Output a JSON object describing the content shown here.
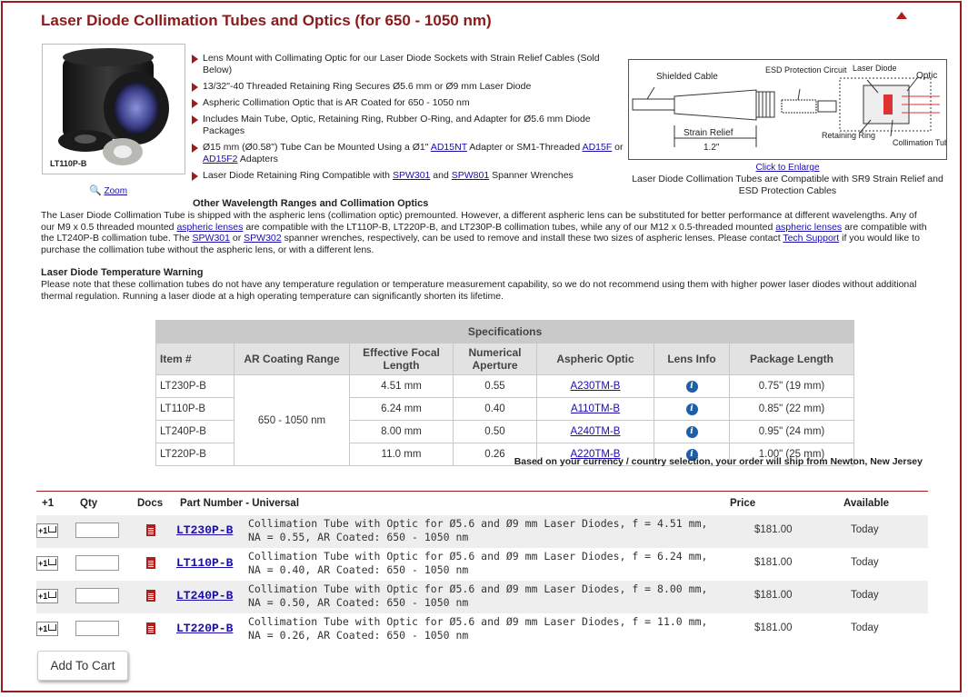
{
  "header": {
    "title": "Laser Diode Collimation Tubes and Optics (for 650 - 1050 nm)"
  },
  "product_image": {
    "caption": "LT110P-B",
    "zoom_label": "Zoom"
  },
  "features": [
    {
      "text": "Lens Mount with Collimating Optic for our Laser Diode Sockets with Strain Relief Cables (Sold Below)"
    },
    {
      "text": "13/32\"-40 Threaded Retaining Ring Secures Ø5.6 mm or Ø9 mm Laser Diode"
    },
    {
      "text": "Aspheric Collimation Optic that is AR Coated for 650 - 1050 nm"
    },
    {
      "text": "Includes Main Tube, Optic, Retaining Ring, Rubber O-Ring, and Adapter for Ø5.6 mm Diode Packages"
    },
    {
      "pre": "Ø15 mm (Ø0.58\") Tube Can be Mounted Using a Ø1\" ",
      "link1": "AD15NT",
      "mid": " Adapter or SM1-Threaded ",
      "link2": "AD15F",
      "mid2": " or ",
      "link3": "AD15F2",
      "post": " Adapters"
    },
    {
      "pre": "Laser Diode Retaining Ring Compatible with ",
      "link1": "SPW301",
      "mid": " and ",
      "link2": "SPW801",
      "post": " Spanner Wrenches"
    }
  ],
  "diagram": {
    "labels": {
      "shielded_cable": "Shielded Cable",
      "esd": "ESD Protection Circuit",
      "laser_diode": "Laser Diode",
      "optic": "Optic",
      "strain_relief": "Strain Relief",
      "strain_relief_len": "1.2\"",
      "retaining_ring": "Retaining Ring",
      "collimation_tube": "Collimation Tube"
    },
    "link": "Click to Enlarge",
    "caption": "Laser Diode Collimation Tubes are Compatible with SR9 Strain Relief and ESD Protection Cables"
  },
  "other_wavelengths": {
    "heading": "Other Wavelength Ranges and Collimation Optics",
    "p1": "The Laser Diode Collimation Tube is shipped with the aspheric lens (collimation optic) premounted. However, a different aspheric lens can be substituted for better performance at different wavelengths. Any of our M9 x 0.5 threaded mounted ",
    "l1": "aspheric lenses",
    "p2": " are compatible with the LT110P-B, LT220P-B, and LT230P-B collimation tubes, while any of our M12 x 0.5-threaded mounted ",
    "l2": "aspheric lenses",
    "p3": " are compatible with the LT240P-B collimation tube. The ",
    "l3": "SPW301",
    "p4": " or ",
    "l4": "SPW302",
    "p5": " spanner wrenches, respectively, can be used to remove and install these two sizes of aspheric lenses. Please contact ",
    "l5": "Tech Support",
    "p6": " if you would like to purchase the collimation tube without the aspheric lens, or with a different lens."
  },
  "temp_warning": {
    "heading": "Laser Diode Temperature Warning",
    "text": "Please note that these collimation tubes do not have any temperature regulation or temperature measurement capability, so we do not recommend using them with higher power laser diodes without additional thermal regulation. Running a laser diode at a high operating temperature can significantly shorten its lifetime."
  },
  "spec_table": {
    "caption": "Specifications",
    "headers": [
      "Item #",
      "AR Coating Range",
      "Effective Focal Length",
      "Numerical Aperture",
      "Aspheric Optic",
      "Lens Info",
      "Package Length"
    ],
    "coating": "650 - 1050 nm",
    "rows": [
      {
        "item": "LT230P-B",
        "efl": "4.51 mm",
        "na": "0.55",
        "optic": "A230TM-B",
        "length": "0.75\" (19 mm)"
      },
      {
        "item": "LT110P-B",
        "efl": "6.24 mm",
        "na": "0.40",
        "optic": "A110TM-B",
        "length": "0.85\" (22 mm)"
      },
      {
        "item": "LT240P-B",
        "efl": "8.00 mm",
        "na": "0.50",
        "optic": "A240TM-B",
        "length": "0.95\" (24 mm)"
      },
      {
        "item": "LT220P-B",
        "efl": "11.0 mm",
        "na": "0.26",
        "optic": "A220TM-B",
        "length": "1.00\" (25 mm)"
      }
    ],
    "info_icon": "info-icon"
  },
  "ship_note": "Based on your currency / country selection, your order will ship from Newton, New Jersey",
  "cart": {
    "headers": {
      "plus1": "+1",
      "qty": "Qty",
      "docs": "Docs",
      "part": "Part Number - Universal",
      "price": "Price",
      "available": "Available"
    },
    "plus_label": "+1",
    "rows": [
      {
        "part": "LT230P-B",
        "desc": "Collimation Tube with Optic for Ø5.6 and Ø9 mm Laser Diodes, f = 4.51 mm, NA = 0.55, AR Coated: 650 - 1050 nm",
        "price": "$181.00",
        "available": "Today",
        "qty": ""
      },
      {
        "part": "LT110P-B",
        "desc": "Collimation Tube with Optic for Ø5.6 and Ø9 mm Laser Diodes, f = 6.24 mm, NA = 0.40, AR Coated: 650 - 1050 nm",
        "price": "$181.00",
        "available": "Today",
        "qty": ""
      },
      {
        "part": "LT240P-B",
        "desc": "Collimation Tube with Optic for Ø5.6 and Ø9 mm Laser Diodes, f = 8.00 mm, NA = 0.50, AR Coated: 650 - 1050 nm",
        "price": "$181.00",
        "available": "Today",
        "qty": ""
      },
      {
        "part": "LT220P-B",
        "desc": "Collimation Tube with Optic for Ø5.6 and Ø9 mm Laser Diodes, f = 11.0 mm, NA = 0.26, AR Coated: 650 - 1050 nm",
        "price": "$181.00",
        "available": "Today",
        "qty": ""
      }
    ],
    "add_to_cart": "Add To Cart"
  },
  "colors": {
    "brand": "#9b1c1c",
    "link": "#1a0dab",
    "info": "#1d5fa8"
  }
}
